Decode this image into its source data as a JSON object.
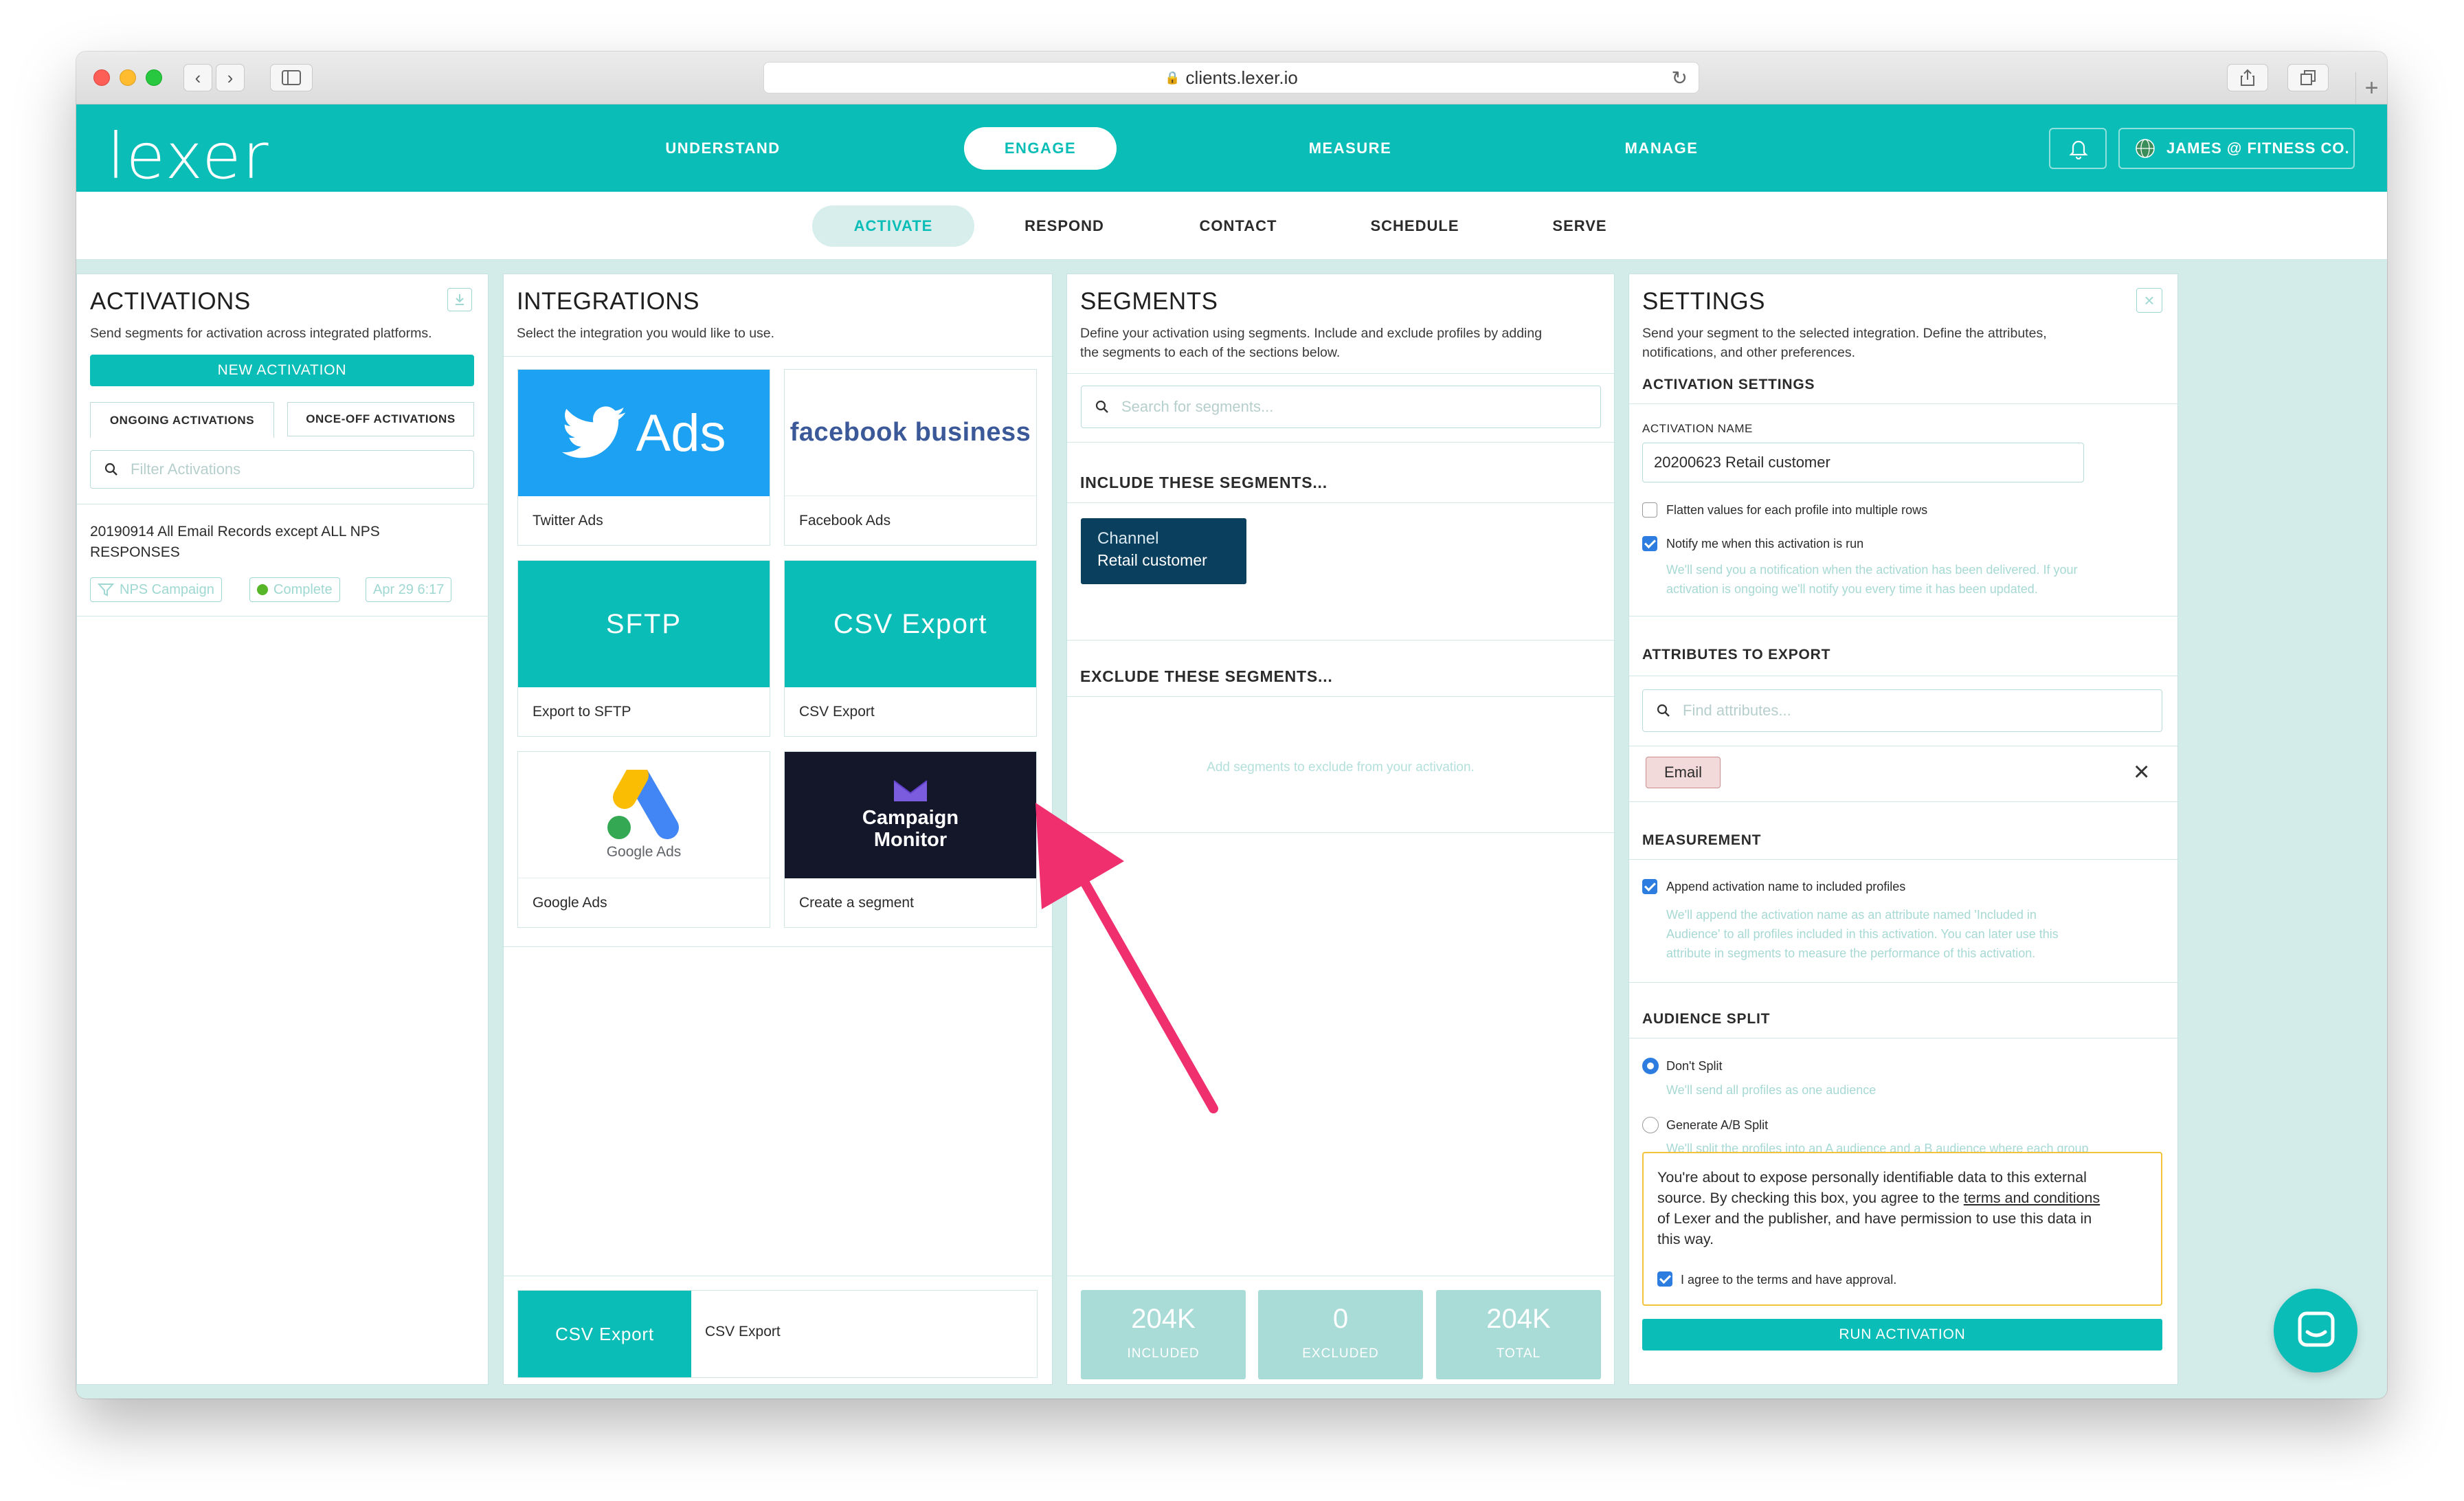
{
  "browser": {
    "url": "clients.lexer.io"
  },
  "app": {
    "logo": "lexer",
    "nav": [
      "UNDERSTAND",
      "ENGAGE",
      "MEASURE",
      "MANAGE"
    ],
    "active_nav": "ENGAGE",
    "user": "JAMES @ FITNESS CO.",
    "subnav": [
      "ACTIVATE",
      "RESPOND",
      "CONTACT",
      "SCHEDULE",
      "SERVE"
    ]
  },
  "activations": {
    "title": "ACTIVATIONS",
    "desc": "Send segments for activation across integrated platforms.",
    "new_button": "NEW ACTIVATION",
    "tabs": [
      "ONGOING ACTIVATIONS",
      "ONCE-OFF ACTIVATIONS"
    ],
    "filter_placeholder": "Filter Activations",
    "item": {
      "name": "20190914 All Email Records except ALL NPS RESPONSES",
      "tag_campaign": "NPS Campaign",
      "tag_status": "Complete",
      "tag_date": "Apr 29 6:17"
    }
  },
  "integrations": {
    "title": "INTEGRATIONS",
    "desc": "Select the integration you would like to use.",
    "tiles": [
      {
        "art": "Ads",
        "label": "Twitter Ads"
      },
      {
        "art": "facebook business",
        "label": "Facebook Ads"
      },
      {
        "art": "SFTP",
        "label": "Export to SFTP"
      },
      {
        "art": "CSV Export",
        "label": "CSV Export"
      },
      {
        "art": "Google Ads",
        "label": "Google Ads"
      },
      {
        "art": "Campaign Monitor",
        "label": "Create a segment"
      }
    ],
    "selected": {
      "art": "CSV Export",
      "label": "CSV Export"
    }
  },
  "segments": {
    "title": "SEGMENTS",
    "desc_1": "Define your activation using segments. Include and exclude profiles by adding",
    "desc_2": "the segments to each of the sections below.",
    "search_placeholder": "Search for segments...",
    "include_title": "INCLUDE THESE SEGMENTS...",
    "include_chip": {
      "line1": "Channel",
      "line2": "Retail customer"
    },
    "exclude_title": "EXCLUDE THESE SEGMENTS...",
    "exclude_hint": "Add segments to exclude from your activation.",
    "stats": [
      {
        "num": "204K",
        "cap": "INCLUDED"
      },
      {
        "num": "0",
        "cap": "EXCLUDED"
      },
      {
        "num": "204K",
        "cap": "TOTAL"
      }
    ]
  },
  "settings": {
    "title": "SETTINGS",
    "desc_1": "Send your segment to the selected integration. Define the attributes,",
    "desc_2": "notifications, and other preferences.",
    "activation_settings": "ACTIVATION SETTINGS",
    "name_label": "ACTIVATION NAME",
    "name_value": "20200623 Retail customer",
    "flatten_label": "Flatten values for each profile into multiple rows",
    "notify_label": "Notify me when this activation is run",
    "notify_hint_1": "We'll send you a notification when the activation has been delivered. If your",
    "notify_hint_2": "activation is ongoing we'll notify you every time it has been updated.",
    "attributes_title": "ATTRIBUTES TO EXPORT",
    "attributes_placeholder": "Find attributes...",
    "attribute_chip": "Email",
    "measurement_title": "MEASUREMENT",
    "append_label": "Append activation name to included profiles",
    "append_hint_1": "We'll append the activation name as an attribute named 'Included in",
    "append_hint_2": "Audience' to all profiles included in this activation. You can later use this",
    "append_hint_3": "attribute in segments to measure the performance of this activation.",
    "split_title": "AUDIENCE SPLIT",
    "dont_split": "Don't Split",
    "dont_split_hint": "We'll send all profiles as one audience",
    "ab_split": "Generate A/B Split",
    "ab_split_hint": "We'll split the profiles into an A audience and a B audience where each group",
    "warning_1": "You're about to expose personally identifiable data to this external",
    "warning_2a": "source. By checking this box, you agree to the ",
    "warning_link": "terms and conditions",
    "warning_3": "of Lexer and the publisher, and have permission to use this data in",
    "warning_4": "this way.",
    "agree_label": "I agree to the terms and have approval.",
    "run_button": "RUN ACTIVATION"
  },
  "colors": {
    "accent": "#0abdb6",
    "annotation_arrow": "#f0306e",
    "chip_navy": "#0b3f5e"
  }
}
